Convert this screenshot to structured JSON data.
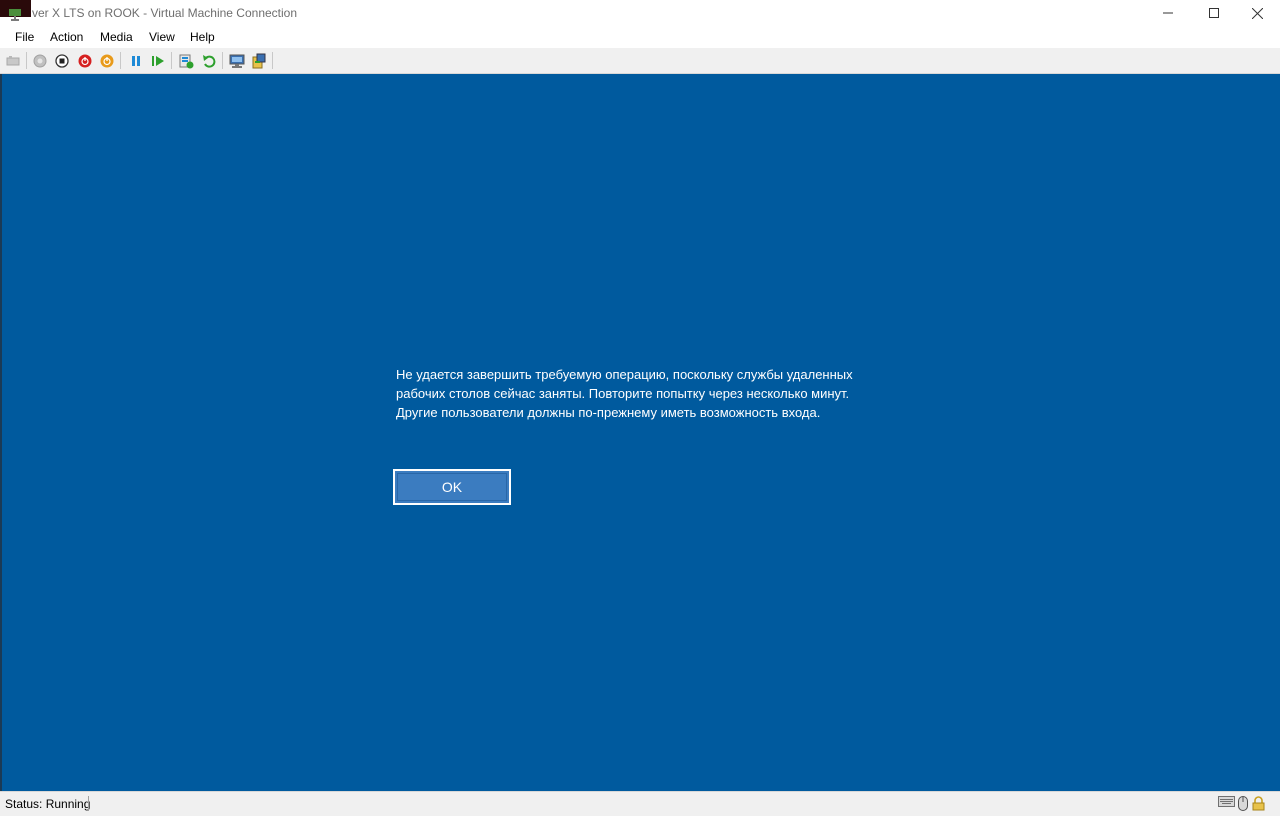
{
  "window": {
    "title": "ver X LTS on ROOK - Virtual Machine Connection",
    "controls": {
      "minimize": "minimize-icon",
      "maximize": "maximize-icon",
      "close": "close-icon"
    }
  },
  "menu": {
    "items": [
      {
        "label": "File"
      },
      {
        "label": "Action"
      },
      {
        "label": "Media"
      },
      {
        "label": "View"
      },
      {
        "label": "Help"
      }
    ]
  },
  "toolbar": {
    "buttons": [
      "ctrl-alt-del-icon",
      "start-icon",
      "turn-off-icon",
      "shut-down-icon",
      "save-icon",
      "pause-icon",
      "reset-icon",
      "checkpoint-icon",
      "revert-icon",
      "enhanced-session-icon",
      "share-icon"
    ],
    "colors": {
      "start_gray": "#a0a0a0",
      "turn_off": "#333333",
      "shutdown_red": "#d62020",
      "save_orange": "#e89a1a",
      "pause_blue": "#1e8ad6",
      "reset_green": "#2da02d"
    }
  },
  "vm": {
    "background": "#005a9e",
    "message_lines": [
      "Не удается завершить требуемую операцию, поскольку службы удаленных",
      "рабочих столов сейчас заняты. Повторите попытку через несколько минут.",
      "Другие пользователи должны по-прежнему иметь возможность входа."
    ],
    "ok_label": "OK"
  },
  "status": {
    "text": "Status: Running",
    "icons": [
      "keyboard-icon",
      "mouse-icon",
      "lock-icon"
    ]
  }
}
